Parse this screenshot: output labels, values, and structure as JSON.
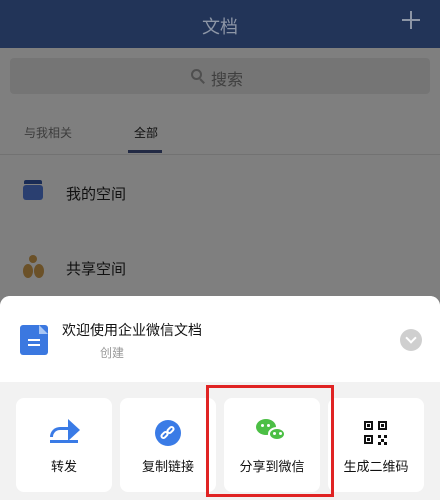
{
  "header": {
    "title": "文档"
  },
  "search": {
    "label": "搜索"
  },
  "tabs": [
    {
      "label": "与我相关"
    },
    {
      "label": "全部"
    }
  ],
  "spaces": [
    {
      "label": "我的空间"
    },
    {
      "label": "共享空间"
    }
  ],
  "sheet": {
    "doc_title": "欢迎使用企业微信文档",
    "doc_subtitle": "创建",
    "actions": [
      {
        "label": "转发",
        "icon": "forward-icon"
      },
      {
        "label": "复制链接",
        "icon": "link-icon"
      },
      {
        "label": "分享到微信",
        "icon": "wechat-icon"
      },
      {
        "label": "生成二维码",
        "icon": "qr-code-icon"
      }
    ]
  },
  "colors": {
    "header": "#223458",
    "accent": "#3a7be6",
    "wechat": "#4cbf45",
    "highlight": "#e02323"
  }
}
